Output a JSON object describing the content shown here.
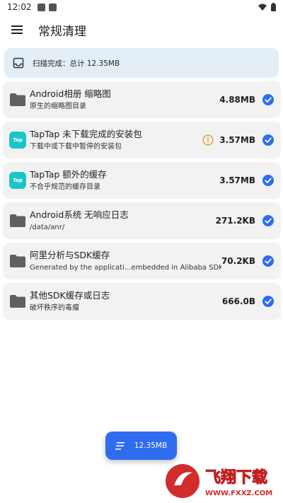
{
  "status_bar": {
    "time": "12:02"
  },
  "app_bar": {
    "title": "常规清理"
  },
  "scan_card": {
    "text": "扫描完成：总计 12.35MB"
  },
  "items": [
    {
      "icon": "folder-icon",
      "title": "Android相册 缩略图",
      "subtitle": "原生的缩略图目录",
      "size": "4.88MB",
      "warning": false,
      "checked": true
    },
    {
      "icon": "taptap-logo",
      "logo_text": "Tap",
      "title": "TapTap 未下载完成的安装包",
      "subtitle": "下载中或下载中暂停的安装包",
      "size": "3.57MB",
      "warning": true,
      "checked": true
    },
    {
      "icon": "taptap-logo",
      "logo_text": "Tap",
      "title": "TapTap 额外的缓存",
      "subtitle": "不合乎规范的缓存目录",
      "size": "3.57MB",
      "warning": false,
      "checked": true
    },
    {
      "icon": "folder-icon",
      "title": "Android系统 无响应日志",
      "subtitle": "/data/anr/",
      "size": "271.2KB",
      "warning": false,
      "checked": true
    },
    {
      "icon": "folder-icon",
      "title": "阿里分析与SDK缓存",
      "subtitle": "Generated by the applicati...embedded in Alibaba SDK",
      "size": "70.2KB",
      "warning": false,
      "checked": true
    },
    {
      "icon": "folder-icon",
      "title": "其他SDK缓存或日志",
      "subtitle": "破坏秩序的毒瘤",
      "size": "666.0B",
      "warning": false,
      "checked": true
    }
  ],
  "fab": {
    "label": "12.35MB"
  },
  "watermark": {
    "text": "飞翔下载",
    "url": "WWW.FXXZ.COM"
  },
  "colors": {
    "accent": "#2f6cf0",
    "card_bg": "#f2f2f2",
    "scan_bg": "#e3eef7",
    "warning": "#f0a020",
    "taptap": "#18c6c8"
  }
}
